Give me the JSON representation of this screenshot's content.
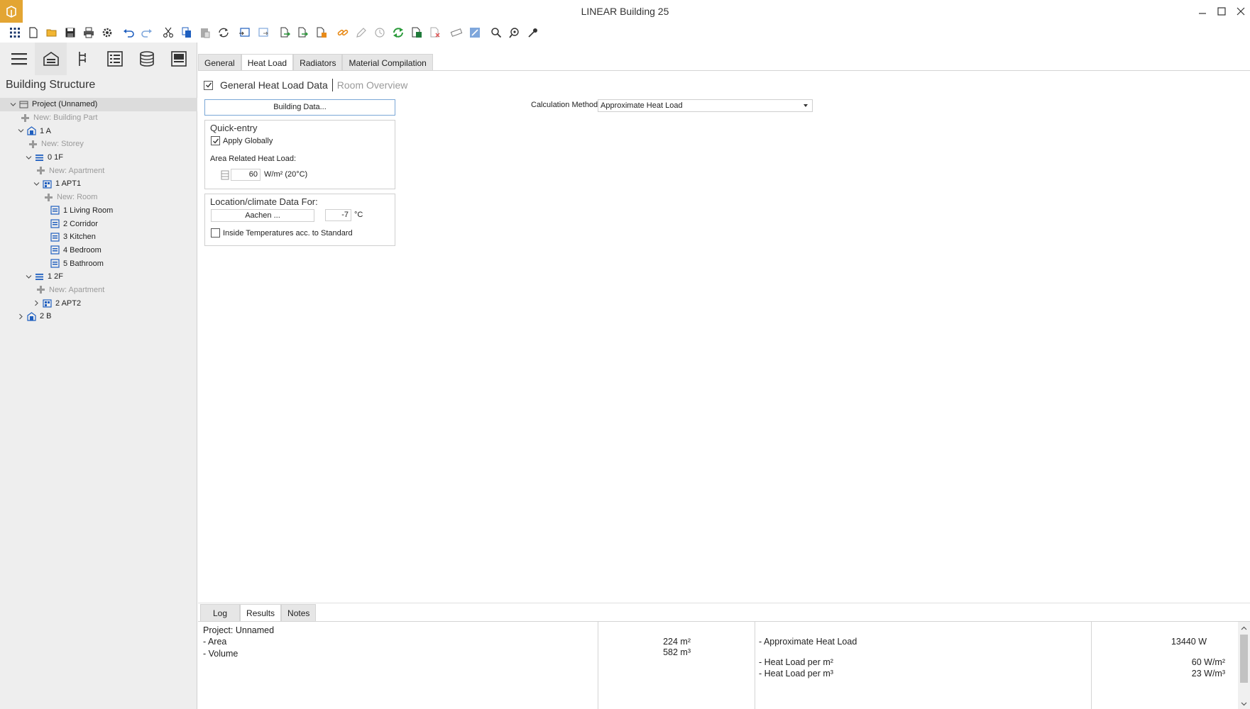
{
  "window": {
    "title": "LINEAR Building 25"
  },
  "toolbar": {
    "icons": [
      "apps-grid-icon",
      "new-file-icon",
      "open-folder-icon",
      "save-icon",
      "print-icon",
      "settings-gear-icon",
      "undo-icon",
      "redo-icon",
      "cut-icon",
      "copy-icon",
      "paste-icon",
      "refresh-icon",
      "import-icon",
      "export-icon",
      "doc-arrow-icon",
      "doc-copy-icon",
      "doc-calc-icon",
      "link-icon",
      "pencil-icon",
      "measure-icon",
      "sync-icon",
      "excel-icon",
      "delete-doc-icon",
      "ruler-icon",
      "edit-view-icon",
      "search-icon",
      "zoom-search-icon",
      "eyedropper-icon"
    ]
  },
  "left_panel": {
    "title": "Building Structure",
    "tabs": [
      "menu-icon",
      "building-icon",
      "network-icon",
      "list-icon",
      "database-icon",
      "panel-icon"
    ],
    "tree": [
      {
        "label": "Project (Unnamed)",
        "level": 0,
        "chevron": "down",
        "icon": "project",
        "selected": true,
        "add": false
      },
      {
        "label": "New: Building Part",
        "level": 1,
        "chevron": "",
        "icon": "plus",
        "add": true
      },
      {
        "label": "1 A",
        "level": 1,
        "chevron": "down",
        "icon": "building",
        "add": false
      },
      {
        "label": "New: Storey",
        "level": 2,
        "chevron": "",
        "icon": "plus",
        "add": true
      },
      {
        "label": "0 1F",
        "level": 2,
        "chevron": "down",
        "icon": "storey",
        "add": false
      },
      {
        "label": "New: Apartment",
        "level": 3,
        "chevron": "",
        "icon": "plus",
        "add": true
      },
      {
        "label": "1 APT1",
        "level": 3,
        "chevron": "down",
        "icon": "apartment",
        "add": false
      },
      {
        "label": "New: Room",
        "level": 4,
        "chevron": "",
        "icon": "plus",
        "add": true
      },
      {
        "label": "1 Living Room",
        "level": 4,
        "chevron": "",
        "icon": "room",
        "add": false
      },
      {
        "label": "2 Corridor",
        "level": 4,
        "chevron": "",
        "icon": "room",
        "add": false
      },
      {
        "label": "3 Kitchen",
        "level": 4,
        "chevron": "",
        "icon": "room",
        "add": false
      },
      {
        "label": "4 Bedroom",
        "level": 4,
        "chevron": "",
        "icon": "room",
        "add": false
      },
      {
        "label": "5 Bathroom",
        "level": 4,
        "chevron": "",
        "icon": "room",
        "add": false
      },
      {
        "label": "1 2F",
        "level": 2,
        "chevron": "down",
        "icon": "storey",
        "add": false
      },
      {
        "label": "New: Apartment",
        "level": 3,
        "chevron": "",
        "icon": "plus",
        "add": true
      },
      {
        "label": "2 APT2",
        "level": 3,
        "chevron": "right",
        "icon": "apartment",
        "add": false
      },
      {
        "label": "2 B",
        "level": 1,
        "chevron": "right",
        "icon": "building",
        "add": false
      }
    ]
  },
  "tabs": {
    "general": "General",
    "heat_load": "Heat Load",
    "radiators": "Radiators",
    "material": "Material Compilation"
  },
  "subhead": {
    "general_heat_load": "General Heat Load Data",
    "room_overview": "Room Overview"
  },
  "building_data_button": "Building Data...",
  "quick_entry": {
    "title": "Quick-entry",
    "apply_globally": "Apply Globally",
    "area_label": "Area Related Heat Load:",
    "value": "60",
    "unit": "W/m² (20°C)"
  },
  "location": {
    "title": "Location/climate Data For:",
    "city": "Aachen ...",
    "temperature": "-7",
    "temp_unit": "°C",
    "inside_temp": "Inside Temperatures acc. to Standard"
  },
  "calculation": {
    "label": "Calculation Method",
    "value": "Approximate Heat Load"
  },
  "bottom_tabs": {
    "log": "Log",
    "results": "Results",
    "notes": "Notes"
  },
  "results": {
    "project": "Project: Unnamed",
    "area_label": "- Area",
    "volume_label": "- Volume",
    "area_value": "224 m²",
    "volume_value": "582 m³",
    "approx_label": "- Approximate Heat Load",
    "per_m2_label": "- Heat Load per m²",
    "per_m3_label": "- Heat Load per m³",
    "approx_value": "13440 W",
    "per_m2_value": "60 W/m²",
    "per_m3_value": "23 W/m³"
  }
}
